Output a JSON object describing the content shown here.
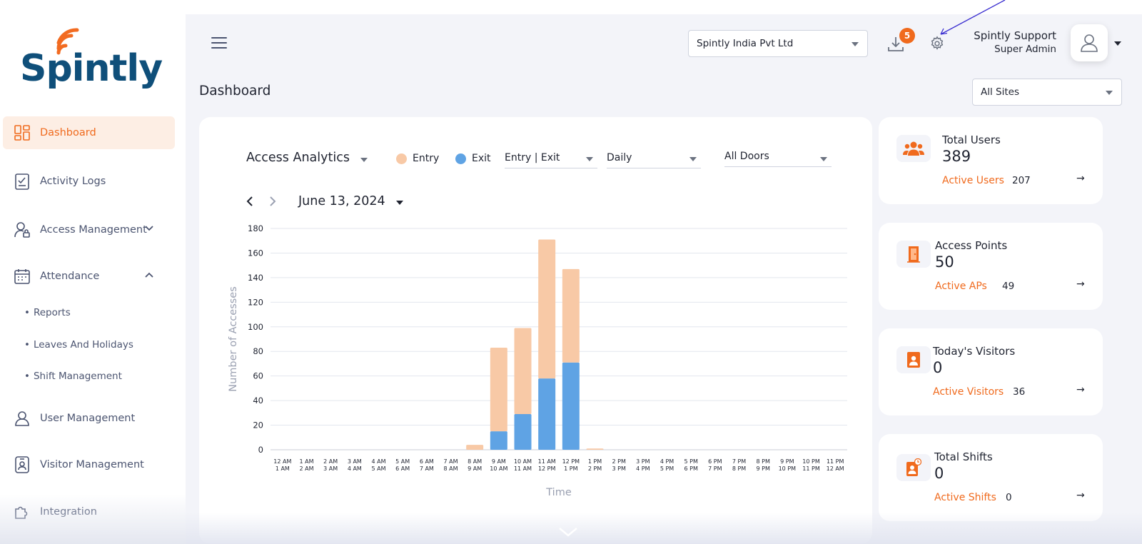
{
  "brand": {
    "name": "Spintly",
    "color": "#0f4f7a",
    "accent": "#f06a1d"
  },
  "sidebar": {
    "items": [
      {
        "label": "Dashboard",
        "icon": "dashboard-grid-icon",
        "active": true
      },
      {
        "label": "Activity Logs",
        "icon": "clipboard-icon"
      },
      {
        "label": "Access Management",
        "icon": "user-lock-icon",
        "chevron": "down"
      },
      {
        "label": "Attendance",
        "icon": "calendar-icon",
        "chevron": "up"
      },
      {
        "label": "User Management",
        "icon": "user-icon"
      },
      {
        "label": "Visitor Management",
        "icon": "visitor-badge-icon"
      },
      {
        "label": "Integration",
        "icon": "puzzle-icon"
      }
    ],
    "attendance_sub": [
      "Reports",
      "Leaves And Holidays",
      "Shift Management"
    ]
  },
  "header": {
    "company": "Spintly India Pvt Ltd",
    "download_badge": "5",
    "user_name": "Spintly Support",
    "user_role": "Super Admin"
  },
  "page": {
    "title": "Dashboard",
    "site_filter": "All Sites"
  },
  "analytics": {
    "title": "Access Analytics",
    "legend": {
      "entry": "Entry",
      "exit": "Exit"
    },
    "filters": {
      "type": "Entry | Exit",
      "period": "Daily",
      "doors": "All Doors"
    },
    "date": "June 13, 2024"
  },
  "chart_data": {
    "type": "bar",
    "stacked": true,
    "xlabel": "Time",
    "ylabel": "Number of Accesses",
    "ylim": [
      0,
      180
    ],
    "yticks": [
      0,
      20,
      40,
      60,
      80,
      100,
      120,
      140,
      160,
      180
    ],
    "grid": true,
    "categories": [
      "12 AM|1 AM",
      "1 AM|2 AM",
      "2 AM|3 AM",
      "3 AM|4 AM",
      "4 AM|5 AM",
      "5 AM|6 AM",
      "6 AM|7 AM",
      "7 AM|8 AM",
      "8 AM|9 AM",
      "9 AM|10 AM",
      "10 AM|11 AM",
      "11 AM|12 PM",
      "12 PM|1 PM",
      "1 PM|2 PM",
      "2 PM|3 PM",
      "3 PM|4 PM",
      "4 PM|5 PM",
      "5 PM|6 PM",
      "6 PM|7 PM",
      "7 PM|8 PM",
      "8 PM|9 PM",
      "9 PM|10 PM",
      "10 PM|11 PM",
      "11 PM|12 AM"
    ],
    "series": [
      {
        "name": "Exit",
        "color": "#5fa3e4",
        "values": [
          0,
          0,
          0,
          0,
          0,
          0,
          0,
          0,
          0,
          15,
          29,
          58,
          71,
          0,
          0,
          0,
          0,
          0,
          0,
          0,
          0,
          0,
          0,
          0
        ]
      },
      {
        "name": "Entry",
        "color": "#f8c9a6",
        "values": [
          0,
          0,
          0,
          0,
          0,
          0,
          0,
          0,
          4,
          68,
          70,
          113,
          76,
          1,
          0,
          0,
          0,
          0,
          0,
          0,
          0,
          0,
          0,
          0
        ]
      }
    ]
  },
  "stats": [
    {
      "label": "Total Users",
      "value": "389",
      "sub_label": "Active Users",
      "sub_value": "207",
      "icon": "users-group-icon"
    },
    {
      "label": "Access Points",
      "value": "50",
      "sub_label": "Active APs",
      "sub_value": "49",
      "icon": "door-icon"
    },
    {
      "label": "Today's Visitors",
      "value": "0",
      "sub_label": "Active Visitors",
      "sub_value": "36",
      "icon": "visitor-card-icon"
    },
    {
      "label": "Total Shifts",
      "value": "0",
      "sub_label": "Active Shifts",
      "sub_value": "0",
      "icon": "shift-clock-icon"
    }
  ]
}
